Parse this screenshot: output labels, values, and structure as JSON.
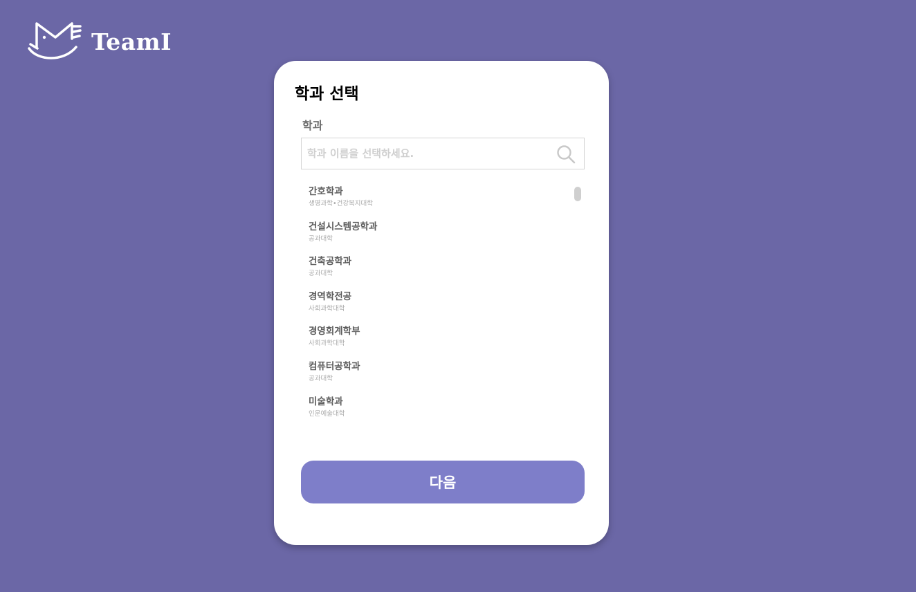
{
  "brand": {
    "name": "TeamI",
    "logo_icon": "cat-envelope-logo"
  },
  "card": {
    "title": "학과 선택",
    "field_label": "학과",
    "search": {
      "value": "",
      "placeholder": "학과 이름을 선택하세요.",
      "icon": "search-icon"
    },
    "departments": [
      {
        "name": "간호학과",
        "college": "생명과학•건강복지대학"
      },
      {
        "name": "건설시스템공학과",
        "college": "공과대학"
      },
      {
        "name": "건축공학과",
        "college": "공과대학"
      },
      {
        "name": "경역학전공",
        "college": "사회과학대학"
      },
      {
        "name": "경영회계학부",
        "college": "사회과학대학"
      },
      {
        "name": "컴퓨터공학과",
        "college": "공과대학"
      },
      {
        "name": "미술학과",
        "college": "인문예술대학"
      }
    ],
    "next_label": "다음"
  },
  "colors": {
    "background": "#6b67a6",
    "button": "#7e7ec9",
    "card": "#ffffff"
  }
}
